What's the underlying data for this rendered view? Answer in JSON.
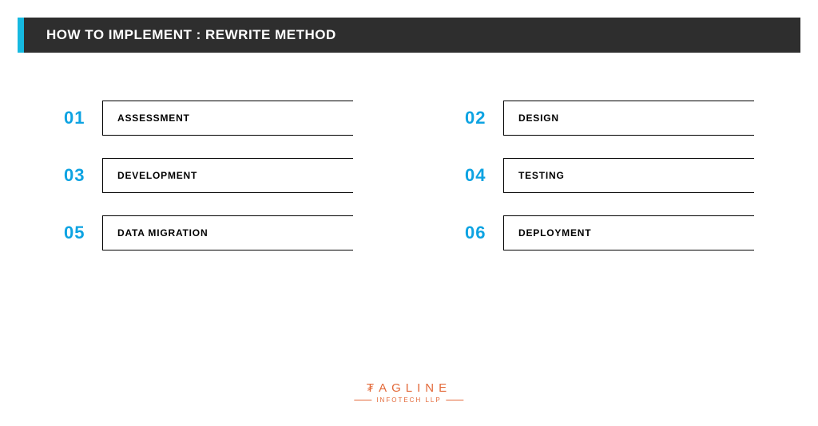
{
  "title": "HOW TO IMPLEMENT : REWRITE METHOD",
  "colors": {
    "accent": "#16b9e0",
    "titleBg": "#2e2e2e",
    "stepNumber": "#0da3e2",
    "logo": "#e36a3a"
  },
  "steps": [
    {
      "num": "01",
      "label": "ASSESSMENT"
    },
    {
      "num": "02",
      "label": "DESIGN"
    },
    {
      "num": "03",
      "label": "DEVELOPMENT"
    },
    {
      "num": "04",
      "label": "TESTING"
    },
    {
      "num": "05",
      "label": "DATA MIGRATION"
    },
    {
      "num": "06",
      "label": "DEPLOYMENT"
    }
  ],
  "logo": {
    "top": "₮AGLINE",
    "sub": "INFOTECH LLP"
  }
}
